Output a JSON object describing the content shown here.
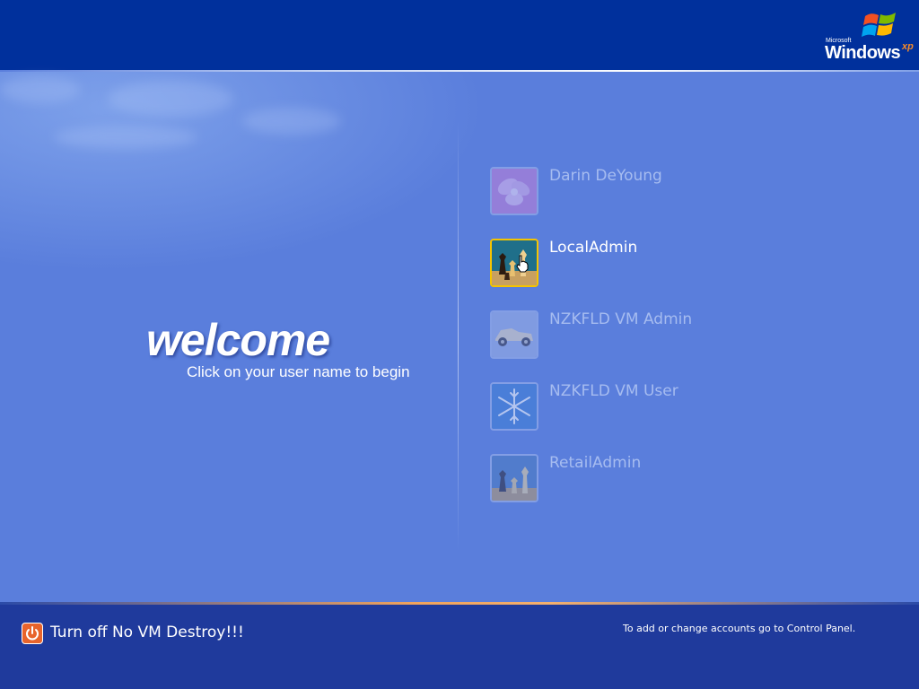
{
  "branding": {
    "company": "Microsoft",
    "product": "Windows",
    "edition": "xp"
  },
  "welcome": {
    "title": "welcome",
    "instruction": "Click on your user name to begin"
  },
  "users": [
    {
      "name": "Darin DeYoung",
      "icon": "flower-icon",
      "selected": false
    },
    {
      "name": "LocalAdmin",
      "icon": "chess-icon",
      "selected": true
    },
    {
      "name": "NZKFLD VM Admin",
      "icon": "car-icon",
      "selected": false
    },
    {
      "name": "NZKFLD VM User",
      "icon": "snowflake-icon",
      "selected": false
    },
    {
      "name": "RetailAdmin",
      "icon": "chess-icon",
      "selected": false
    }
  ],
  "footer": {
    "turn_off_label": "Turn off No VM Destroy!!!",
    "control_panel_hint": "To add or change accounts go to Control Panel."
  },
  "colors": {
    "top_bar": "#00309c",
    "main_background": "#5a7edc",
    "bottom_bar": "#1f3a9c",
    "selected_border": "#f5c400",
    "power_button": "#e8642c"
  }
}
